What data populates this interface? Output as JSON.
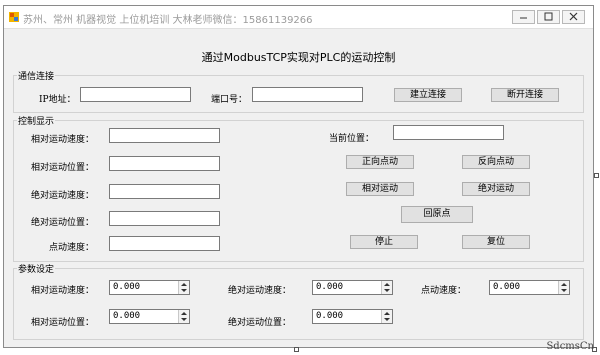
{
  "window": {
    "title": "苏州、常州 机器视觉 上位机培训     大林老师微信：15861139266",
    "heading": "通过ModbusTCP实现对PLC的运动控制"
  },
  "comm": {
    "group_label": "通信连接",
    "ip_label": "IP地址：",
    "ip_value": "",
    "port_label": "端口号：",
    "port_value": "",
    "connect_label": "建立连接",
    "disconnect_label": "断开连接"
  },
  "control": {
    "group_label": "控制显示",
    "rel_speed_label": "相对运动速度：",
    "rel_pos_label": "相对运动位置：",
    "abs_speed_label": "绝对运动速度：",
    "abs_pos_label": "绝对运动位置：",
    "jog_speed_label": "点动速度：",
    "current_pos_label": "当前位置：",
    "jog_fwd_label": "正向点动",
    "jog_rev_label": "反向点动",
    "rel_move_label": "相对运动",
    "abs_move_label": "绝对运动",
    "home_label": "回原点",
    "stop_label": "停止",
    "reset_label": "复位"
  },
  "params": {
    "group_label": "参数设定",
    "rel_speed_label": "相对运动速度：",
    "rel_speed_value": "0.000",
    "abs_speed_label": "绝对运动速度：",
    "abs_speed_value": "0.000",
    "jog_speed_label": "点动速度：",
    "jog_speed_value": "0.000",
    "rel_pos_label": "相对运动位置：",
    "rel_pos_value": "0.000",
    "abs_pos_label": "绝对运动位置：",
    "abs_pos_value": "0.000"
  },
  "watermark": "SdcmsCn"
}
